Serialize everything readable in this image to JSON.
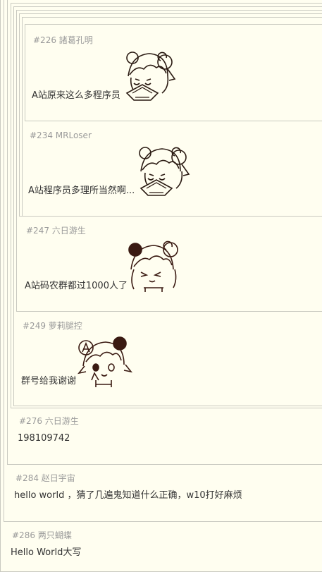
{
  "comments": [
    {
      "floor": "#226",
      "user": "諸葛孔明",
      "text": "A站原来这么多程序员",
      "emote": "ac-girl-fan-crying"
    },
    {
      "floor": "#234",
      "user": "MRLoser",
      "text": "A站程序员多理所当然啊...",
      "emote": "ac-girl-fan-crying"
    },
    {
      "floor": "#247",
      "user": "六日游生",
      "text": "A站码农群都过1000人了",
      "emote": "ac-girl-squinting"
    },
    {
      "floor": "#249",
      "user": "萝莉腿控",
      "text": "群号给我谢谢",
      "emote": "ac-girl-peace-sign"
    },
    {
      "floor": "#276",
      "user": "六日游生",
      "text": "198109742"
    },
    {
      "floor": "#284",
      "user": "赵日宇宙",
      "text": "hello world ，猜了几遍鬼知道什么正确，w10打好麻烦"
    },
    {
      "floor": "#286",
      "user": "两只蝴蝶",
      "text": "Hello World大写"
    }
  ]
}
